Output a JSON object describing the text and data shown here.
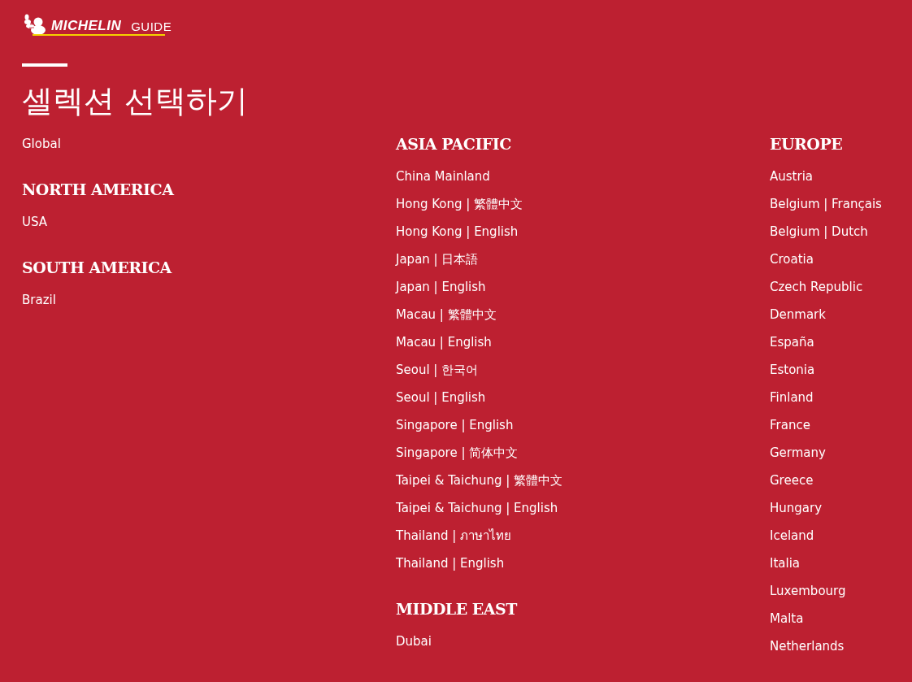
{
  "logo": {
    "wordmark": "MICHELIN",
    "suffix": "GUIDE"
  },
  "title": "셀렉션 선택하기",
  "columns": [
    {
      "sections": [
        {
          "links": [
            "Global"
          ]
        },
        {
          "heading": "NORTH AMERICA",
          "links": [
            "USA"
          ]
        },
        {
          "heading": "SOUTH AMERICA",
          "links": [
            "Brazil"
          ]
        }
      ]
    },
    {
      "sections": [
        {
          "heading": "ASIA PACIFIC",
          "links": [
            "China Mainland",
            "Hong Kong | 繁體中文",
            "Hong Kong | English",
            "Japan | 日本語",
            "Japan | English",
            "Macau | 繁體中文",
            "Macau | English",
            "Seoul | 한국어",
            "Seoul | English",
            "Singapore | English",
            "Singapore | 简体中文",
            "Taipei & Taichung | 繁體中文",
            "Taipei & Taichung | English",
            "Thailand | ภาษาไทย",
            "Thailand | English"
          ]
        },
        {
          "heading": "MIDDLE EAST",
          "links": [
            "Dubai"
          ]
        }
      ]
    },
    {
      "sections": [
        {
          "heading": "EUROPE",
          "links": [
            "Austria",
            "Belgium | Français",
            "Belgium | Dutch",
            "Croatia",
            "Czech Republic",
            "Denmark",
            "España",
            "Estonia",
            "Finland",
            "France",
            "Germany",
            "Greece",
            "Hungary",
            "Iceland",
            "Italia",
            "Luxembourg",
            "Malta",
            "Netherlands"
          ]
        }
      ]
    }
  ]
}
